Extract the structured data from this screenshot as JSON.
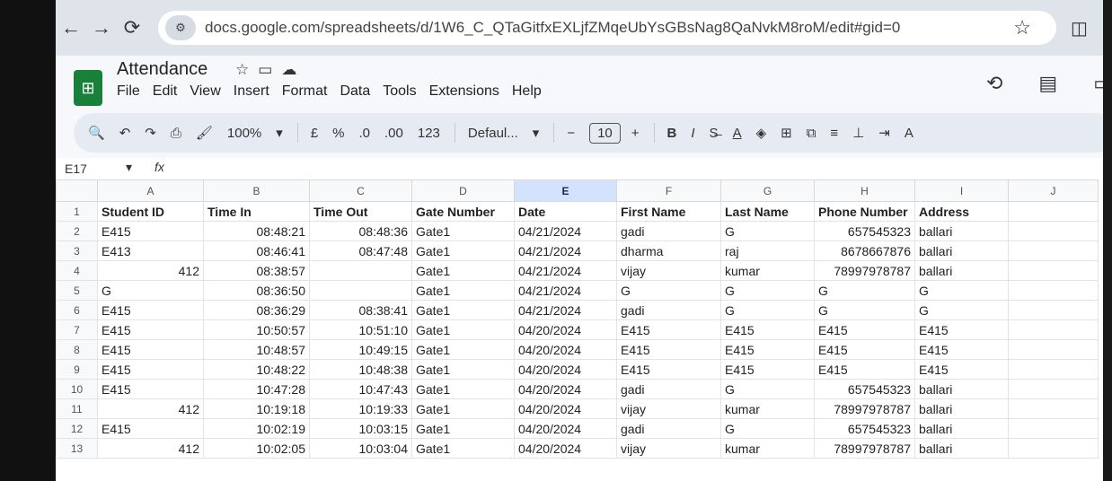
{
  "browser": {
    "url": "docs.google.com/spreadsheets/d/1W6_C_QTaGitfxEXLjfZMqeUbYsGBsNag8QaNvkM8roM/edit#gid=0"
  },
  "doc": {
    "title": "Attendance",
    "menu": [
      "File",
      "Edit",
      "View",
      "Insert",
      "Format",
      "Data",
      "Tools",
      "Extensions",
      "Help"
    ]
  },
  "toolbar": {
    "zoom": "100%",
    "currency": "£",
    "percent": "%",
    "dec_decrease": ".0",
    "dec_increase": ".00",
    "number_format": "123",
    "font": "Defaul...",
    "font_size": "10",
    "bold": "B",
    "italic": "I"
  },
  "formula_bar": {
    "cell_ref": "E17",
    "fx": "fx"
  },
  "columns": [
    "A",
    "B",
    "C",
    "D",
    "E",
    "F",
    "G",
    "H",
    "I",
    "J"
  ],
  "rows": [
    {
      "n": "1",
      "cells": [
        "Student ID",
        "Time In",
        "Time Out",
        "Gate Number",
        "Date",
        "First Name",
        "Last Name",
        "Phone Number",
        "Address",
        ""
      ]
    },
    {
      "n": "2",
      "cells": [
        "E415",
        "08:48:21",
        "08:48:36",
        "Gate1",
        "04/21/2024",
        "gadi",
        "G",
        "657545323",
        "ballari",
        ""
      ]
    },
    {
      "n": "3",
      "cells": [
        "E413",
        "08:46:41",
        "08:47:48",
        "Gate1",
        "04/21/2024",
        "dharma",
        "raj",
        "8678667876",
        "ballari",
        ""
      ]
    },
    {
      "n": "4",
      "cells": [
        "412",
        "08:38:57",
        "",
        "Gate1",
        "04/21/2024",
        "vijay",
        "kumar",
        "78997978787",
        "ballari",
        ""
      ]
    },
    {
      "n": "5",
      "cells": [
        "G",
        "08:36:50",
        "",
        "Gate1",
        "04/21/2024",
        "G",
        "G",
        "G",
        "G",
        ""
      ]
    },
    {
      "n": "6",
      "cells": [
        "E415",
        "08:36:29",
        "08:38:41",
        "Gate1",
        "04/21/2024",
        "gadi",
        "G",
        "G",
        "G",
        ""
      ]
    },
    {
      "n": "7",
      "cells": [
        "E415",
        "10:50:57",
        "10:51:10",
        "Gate1",
        "04/20/2024",
        "E415",
        "E415",
        "E415",
        "E415",
        ""
      ]
    },
    {
      "n": "8",
      "cells": [
        "E415",
        "10:48:57",
        "10:49:15",
        "Gate1",
        "04/20/2024",
        "E415",
        "E415",
        "E415",
        "E415",
        ""
      ]
    },
    {
      "n": "9",
      "cells": [
        "E415",
        "10:48:22",
        "10:48:38",
        "Gate1",
        "04/20/2024",
        "E415",
        "E415",
        "E415",
        "E415",
        ""
      ]
    },
    {
      "n": "10",
      "cells": [
        "E415",
        "10:47:28",
        "10:47:43",
        "Gate1",
        "04/20/2024",
        "gadi",
        "G",
        "657545323",
        "ballari",
        ""
      ]
    },
    {
      "n": "11",
      "cells": [
        "412",
        "10:19:18",
        "10:19:33",
        "Gate1",
        "04/20/2024",
        "vijay",
        "kumar",
        "78997978787",
        "ballari",
        ""
      ]
    },
    {
      "n": "12",
      "cells": [
        "E415",
        "10:02:19",
        "10:03:15",
        "Gate1",
        "04/20/2024",
        "gadi",
        "G",
        "657545323",
        "ballari",
        ""
      ]
    },
    {
      "n": "13",
      "cells": [
        "412",
        "10:02:05",
        "10:03:04",
        "Gate1",
        "04/20/2024",
        "vijay",
        "kumar",
        "78997978787",
        "ballari",
        ""
      ]
    }
  ]
}
